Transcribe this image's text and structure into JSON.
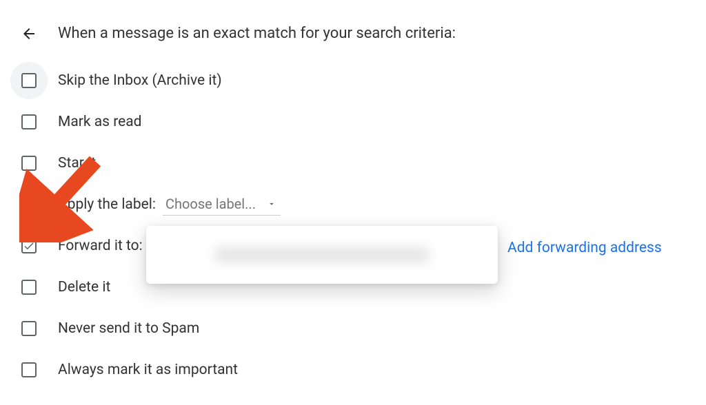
{
  "header": {
    "title": "When a message is an exact match for your search criteria:"
  },
  "options": {
    "skip": {
      "label": "Skip the Inbox (Archive it)",
      "checked": false,
      "hover": true
    },
    "read": {
      "label": "Mark as read",
      "checked": false
    },
    "star": {
      "label": "Star it",
      "checked": false
    },
    "label": {
      "label": "Apply the label:",
      "select_placeholder": "Choose label...",
      "checked": false
    },
    "forward": {
      "label": "Forward it to:",
      "checked": true
    },
    "delete": {
      "label": "Delete it",
      "checked": false
    },
    "spam": {
      "label": "Never send it to Spam",
      "checked": false
    },
    "important": {
      "label": "Always mark it as important",
      "checked": false
    }
  },
  "forward_link": "Add forwarding address",
  "colors": {
    "arrow": "#E8481F",
    "link": "#1a73e8"
  }
}
